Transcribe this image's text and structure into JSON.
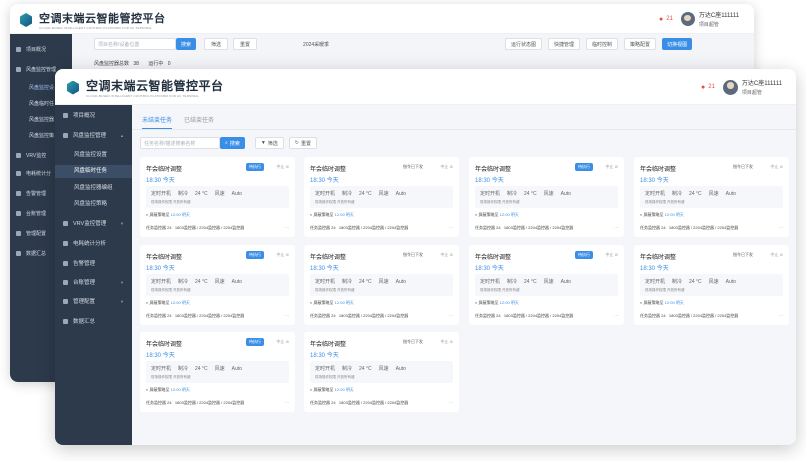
{
  "app": {
    "title": "空调末端云智能管控平台",
    "subtitle": "CLOUD-BASED INTELLIGENT CONTROL PLATFORM FOR AC TERMINAL"
  },
  "user": {
    "name": "万达C座111111",
    "role": "项目超管",
    "notification_count": "21"
  },
  "colors": {
    "primary": "#3a8ee6",
    "sidebar": "#2d3a4b",
    "alert": "#e94d4d"
  },
  "back_window": {
    "search_placeholder": "项目名称/设备位置",
    "search_btn": "搜索",
    "filter_btn": "筛选",
    "reset_btn": "重置",
    "season": "2024采暖季",
    "actions": [
      "运行状态图",
      "快捷管理",
      "临时控制",
      "策略配置",
      "切换视图"
    ],
    "stats": {
      "total_label": "风盘监控器总数",
      "total_value": "38",
      "running_label": "运行中",
      "running_value": "0"
    },
    "sidebar": {
      "items": [
        "项目概况",
        "风盘监控管理",
        "VRV监控",
        "电耗统计分",
        "告警管理",
        "台账管理",
        "管理配置",
        "数据汇总"
      ],
      "subitems": [
        "风盘监控设",
        "风盘临时任",
        "风盘监控器",
        "风盘监控策"
      ]
    }
  },
  "sidebar": {
    "items": [
      {
        "label": "项目概况",
        "icon": "dashboard-icon"
      },
      {
        "label": "风盘监控管理",
        "icon": "fan-icon"
      },
      {
        "label": "VRV监控管理",
        "icon": "vrv-icon"
      },
      {
        "label": "电耗统计分析",
        "icon": "chart-icon"
      },
      {
        "label": "告警管理",
        "icon": "alarm-icon"
      },
      {
        "label": "台账管理",
        "icon": "ledger-icon"
      },
      {
        "label": "管理配置",
        "icon": "settings-icon"
      },
      {
        "label": "数据汇总",
        "icon": "data-icon"
      }
    ],
    "subitems": [
      "风盘监控设置",
      "风盘临时任务",
      "风盘监控器编组",
      "风盘监控策略"
    ]
  },
  "tabs": [
    "未结束任务",
    "已结束任务"
  ],
  "toolbar": {
    "search_placeholder": "任务名称/描述搜索名称",
    "search_btn": "搜索",
    "filter_btn": "筛选",
    "reset_btn": "重置"
  },
  "cards": [
    {
      "title": "年会临时调整",
      "status": "待执行",
      "stop": "中止",
      "time": "18:30",
      "day": "今天",
      "mode": "定时开机",
      "cool": "制冷",
      "temp": "24 °C",
      "fan": "风速",
      "fan_val": "Auto",
      "note1": "现场操作权限",
      "note2": "开放所有键",
      "plan": "屏蔽策略至",
      "plan_time": "12:00",
      "plan_day": "明天",
      "count_label": "任务监控器",
      "count": "24",
      "devices": "1803监控器 / 2204监控器 / 2204监控器"
    },
    {
      "title": "年会临时调整",
      "status": "指令已下发",
      "stop": "中止",
      "time": "18:30",
      "day": "今天",
      "mode": "定时开机",
      "cool": "制冷",
      "temp": "24 °C",
      "fan": "风速",
      "fan_val": "Auto",
      "note1": "现场操作权限",
      "note2": "开放所有键",
      "plan": "屏蔽策略至",
      "plan_time": "12:00",
      "plan_day": "明天",
      "count_label": "任务监控器",
      "count": "24",
      "devices": "1803监控器 / 2204监控器 / 2204监控器"
    },
    {
      "title": "年会临时调整",
      "status": "待执行",
      "stop": "中止",
      "time": "18:30",
      "day": "今天",
      "mode": "定时开机",
      "cool": "制冷",
      "temp": "24 °C",
      "fan": "风速",
      "fan_val": "Auto",
      "note1": "现场操作权限",
      "note2": "开放所有键",
      "plan": "屏蔽策略至",
      "plan_time": "12:00",
      "plan_day": "明天",
      "count_label": "任务监控器",
      "count": "24",
      "devices": "1803监控器 / 2204监控器 / 2204监控器"
    },
    {
      "title": "年会临时调整",
      "status": "指令已下发",
      "stop": "中止",
      "time": "18:30",
      "day": "今天",
      "mode": "定时开机",
      "cool": "制冷",
      "temp": "24 °C",
      "fan": "风速",
      "fan_val": "Auto",
      "note1": "现场操作权限",
      "note2": "开放所有键",
      "plan": "屏蔽策略至",
      "plan_time": "12:00",
      "plan_day": "明天",
      "count_label": "任务监控器",
      "count": "24",
      "devices": "1803监控器 / 2204监控器 / 2204监控器"
    },
    {
      "title": "年会临时调整",
      "status": "待执行",
      "stop": "中止",
      "time": "18:30",
      "day": "今天",
      "mode": "定时开机",
      "cool": "制冷",
      "temp": "24 °C",
      "fan": "风速",
      "fan_val": "Auto",
      "note1": "现场操作权限",
      "note2": "开放所有键",
      "plan": "屏蔽策略至",
      "plan_time": "12:00",
      "plan_day": "明天",
      "count_label": "任务监控器",
      "count": "24",
      "devices": "1803监控器 / 2204监控器 / 2204监控器"
    },
    {
      "title": "年会临时调整",
      "status": "指令已下发",
      "stop": "中止",
      "time": "18:30",
      "day": "今天",
      "mode": "定时开机",
      "cool": "制冷",
      "temp": "24 °C",
      "fan": "风速",
      "fan_val": "Auto",
      "note1": "现场操作权限",
      "note2": "开放所有键",
      "plan": "屏蔽策略至",
      "plan_time": "12:00",
      "plan_day": "明天",
      "count_label": "任务监控器",
      "count": "24",
      "devices": "1803监控器 / 2204监控器 / 2204监控器"
    },
    {
      "title": "年会临时调整",
      "status": "待执行",
      "stop": "中止",
      "time": "18:30",
      "day": "今天",
      "mode": "定时开机",
      "cool": "制冷",
      "temp": "24 °C",
      "fan": "风速",
      "fan_val": "Auto",
      "note1": "现场操作权限",
      "note2": "开放所有键",
      "plan": "屏蔽策略至",
      "plan_time": "12:00",
      "plan_day": "明天",
      "count_label": "任务监控器",
      "count": "24",
      "devices": "1803监控器 / 2204监控器 / 2204监控器"
    },
    {
      "title": "年会临时调整",
      "status": "指令已下发",
      "stop": "中止",
      "time": "18:30",
      "day": "今天",
      "mode": "定时开机",
      "cool": "制冷",
      "temp": "24 °C",
      "fan": "风速",
      "fan_val": "Auto",
      "note1": "现场操作权限",
      "note2": "开放所有键",
      "plan": "屏蔽策略至",
      "plan_time": "12:00",
      "plan_day": "明天",
      "count_label": "任务监控器",
      "count": "24",
      "devices": "1803监控器 / 2204监控器 / 2204监控器"
    },
    {
      "title": "年会临时调整",
      "status": "待执行",
      "stop": "中止",
      "time": "18:30",
      "day": "今天",
      "mode": "定时开机",
      "cool": "制冷",
      "temp": "24 °C",
      "fan": "风速",
      "fan_val": "Auto",
      "note1": "现场操作权限",
      "note2": "开放所有键",
      "plan": "屏蔽策略至",
      "plan_time": "12:00",
      "plan_day": "明天",
      "count_label": "任务监控器",
      "count": "24",
      "devices": "1803监控器 / 2204监控器 / 2204监控器"
    },
    {
      "title": "年会临时调整",
      "status": "指令已下发",
      "stop": "中止",
      "time": "18:30",
      "day": "今天",
      "mode": "定时开机",
      "cool": "制冷",
      "temp": "24 °C",
      "fan": "风速",
      "fan_val": "Auto",
      "note1": "现场操作权限",
      "note2": "开放所有键",
      "plan": "屏蔽策略至",
      "plan_time": "12:00",
      "plan_day": "明天",
      "count_label": "任务监控器",
      "count": "24",
      "devices": "1803监控器 / 2204监控器 / 2204监控器"
    }
  ]
}
